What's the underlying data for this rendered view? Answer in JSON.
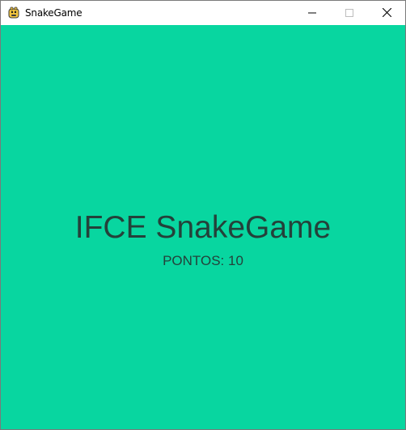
{
  "window": {
    "title": "SnakeGame",
    "app_icon": "python-snake-icon",
    "controls": {
      "minimize": "minimize-icon",
      "maximize": "maximize-icon",
      "close": "close-icon"
    }
  },
  "game": {
    "title": "IFCE SnakeGame",
    "score_label": "PONTOS: ",
    "score_value": "10",
    "colors": {
      "background": "#08d6a0",
      "text": "#24413a"
    }
  }
}
